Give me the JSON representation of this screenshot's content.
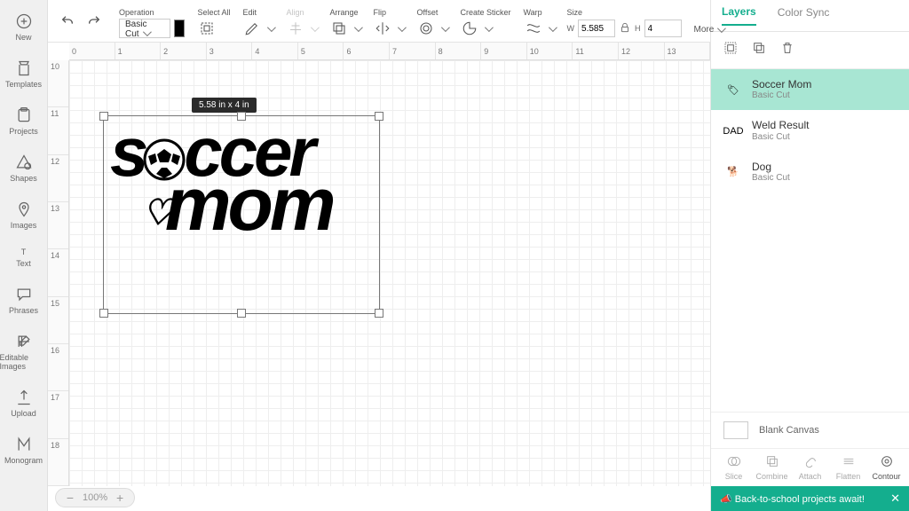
{
  "rail": [
    {
      "label": "New"
    },
    {
      "label": "Templates"
    },
    {
      "label": "Projects"
    },
    {
      "label": "Shapes"
    },
    {
      "label": "Images"
    },
    {
      "label": "Text"
    },
    {
      "label": "Phrases"
    },
    {
      "label": "Editable Images"
    },
    {
      "label": "Upload"
    },
    {
      "label": "Monogram"
    }
  ],
  "toolbar": {
    "operation_label": "Operation",
    "operation_value": "Basic Cut",
    "select_all": "Select All",
    "edit": "Edit",
    "align": "Align",
    "arrange": "Arrange",
    "flip": "Flip",
    "offset": "Offset",
    "create_sticker": "Create Sticker",
    "warp": "Warp",
    "size": "Size",
    "w_label": "W",
    "w_value": "5.585",
    "h_label": "H",
    "h_value": "4",
    "more": "More"
  },
  "ruler_h": [
    "0",
    "1",
    "2",
    "3",
    "4",
    "5",
    "6",
    "7",
    "8",
    "9",
    "10",
    "11",
    "12",
    "13"
  ],
  "ruler_v": [
    "10",
    "11",
    "12",
    "13",
    "14",
    "15",
    "16",
    "17",
    "18"
  ],
  "selection": {
    "dim_tag": "5.58  in x 4  in"
  },
  "artwork": {
    "line1a": "s",
    "line1b": "ccer",
    "line2": "mom"
  },
  "zoom": {
    "value": "100%"
  },
  "panel": {
    "tab_layers": "Layers",
    "tab_colorsync": "Color Sync",
    "layers": [
      {
        "name": "Soccer Mom",
        "sub": "Basic Cut",
        "selected": true,
        "thumb": "🏷"
      },
      {
        "name": "Weld Result",
        "sub": "Basic Cut",
        "selected": false,
        "thumb": "DAD"
      },
      {
        "name": "Dog",
        "sub": "Basic Cut",
        "selected": false,
        "thumb": "🐕"
      }
    ],
    "blank_canvas": "Blank Canvas",
    "ops": [
      "Slice",
      "Combine",
      "Attach",
      "Flatten",
      "Contour"
    ]
  },
  "promo": {
    "text": "Back-to-school projects await!",
    "close": "✕"
  }
}
